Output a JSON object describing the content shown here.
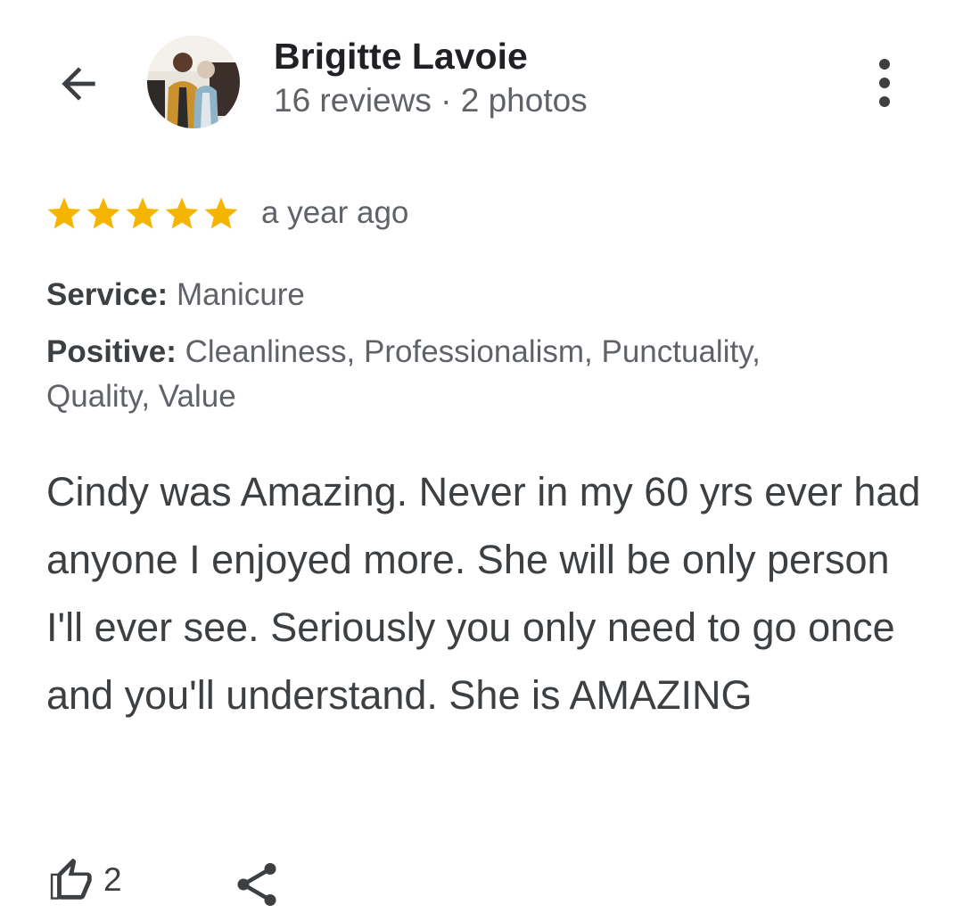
{
  "header": {
    "back_icon": "arrow-left-icon",
    "reviewer_name": "Brigitte Lavoie",
    "reviewer_meta": "16 reviews · 2 photos",
    "more_icon": "more-vertical-icon"
  },
  "review": {
    "rating": 5,
    "rating_max": 5,
    "star_color": "#F5B400",
    "time_ago": "a year ago",
    "service_label": "Service:",
    "service_value": "Manicure",
    "positive_label": "Positive:",
    "positive_value": "Cleanliness, Professionalism, Punctuality, Quality, Value",
    "text": "Cindy was Amazing. Never in my 60 yrs ever had anyone I enjoyed more. She will be only person I'll ever see. Seriously you only need to go once and you'll understand. She is AMAZING"
  },
  "actions": {
    "like_icon": "thumbs-up-icon",
    "like_count": "2",
    "share_icon": "share-icon"
  }
}
